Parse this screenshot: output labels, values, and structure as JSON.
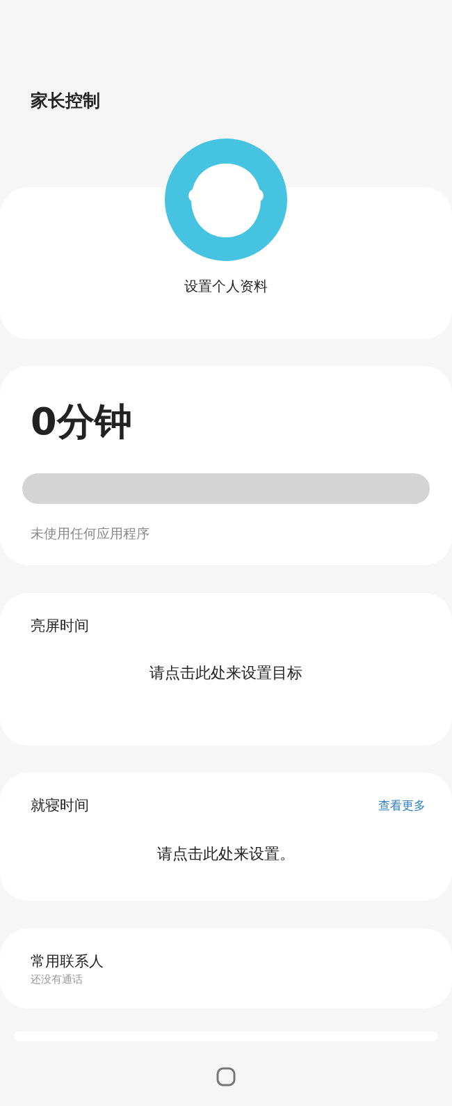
{
  "header": {
    "title": "家长控制"
  },
  "profile": {
    "label": "设置个人资料"
  },
  "usage": {
    "total": "0分钟",
    "level": 0,
    "caption": "未使用任何应用程序"
  },
  "screen_time": {
    "title": "亮屏时间",
    "action": "请点击此处来设置目标"
  },
  "bedtime": {
    "title": "就寝时间",
    "link": "查看更多",
    "action": "请点击此处来设置。"
  },
  "contacts": {
    "title": "常用联系人",
    "subtitle": "还没有通话"
  }
}
